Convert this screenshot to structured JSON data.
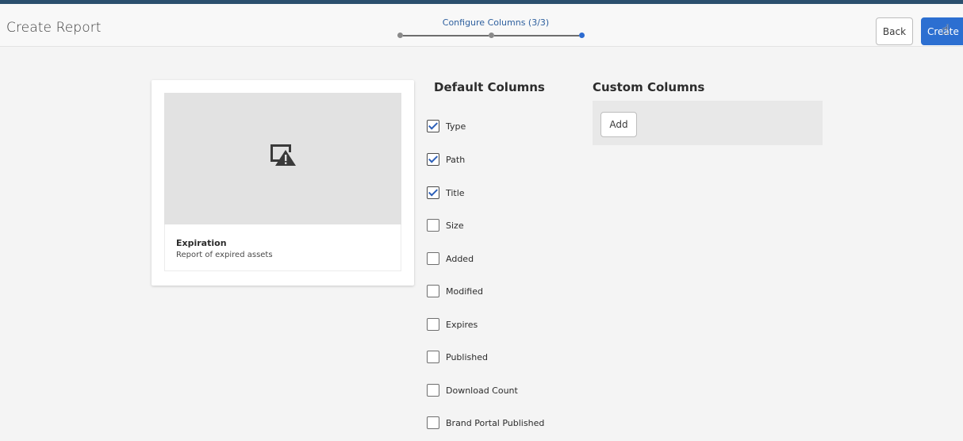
{
  "header": {
    "title": "Create Report",
    "wizard_step_label": "Configure Columns (3/3)",
    "back_label": "Back",
    "create_label": "Create"
  },
  "template_card": {
    "icon": "image-warning-icon",
    "title": "Expiration",
    "description": "Report of expired assets"
  },
  "default_columns": {
    "heading": "Default Columns",
    "items": [
      {
        "label": "Type",
        "checked": true
      },
      {
        "label": "Path",
        "checked": true
      },
      {
        "label": "Title",
        "checked": true
      },
      {
        "label": "Size",
        "checked": false
      },
      {
        "label": "Added",
        "checked": false
      },
      {
        "label": "Modified",
        "checked": false
      },
      {
        "label": "Expires",
        "checked": false
      },
      {
        "label": "Published",
        "checked": false
      },
      {
        "label": "Download Count",
        "checked": false
      },
      {
        "label": "Brand Portal Published",
        "checked": false
      }
    ]
  },
  "custom_columns": {
    "heading": "Custom Columns",
    "add_label": "Add"
  },
  "colors": {
    "accent": "#2c6fd1",
    "topbar": "#2b4f6e",
    "step_label": "#2d5f9e"
  }
}
